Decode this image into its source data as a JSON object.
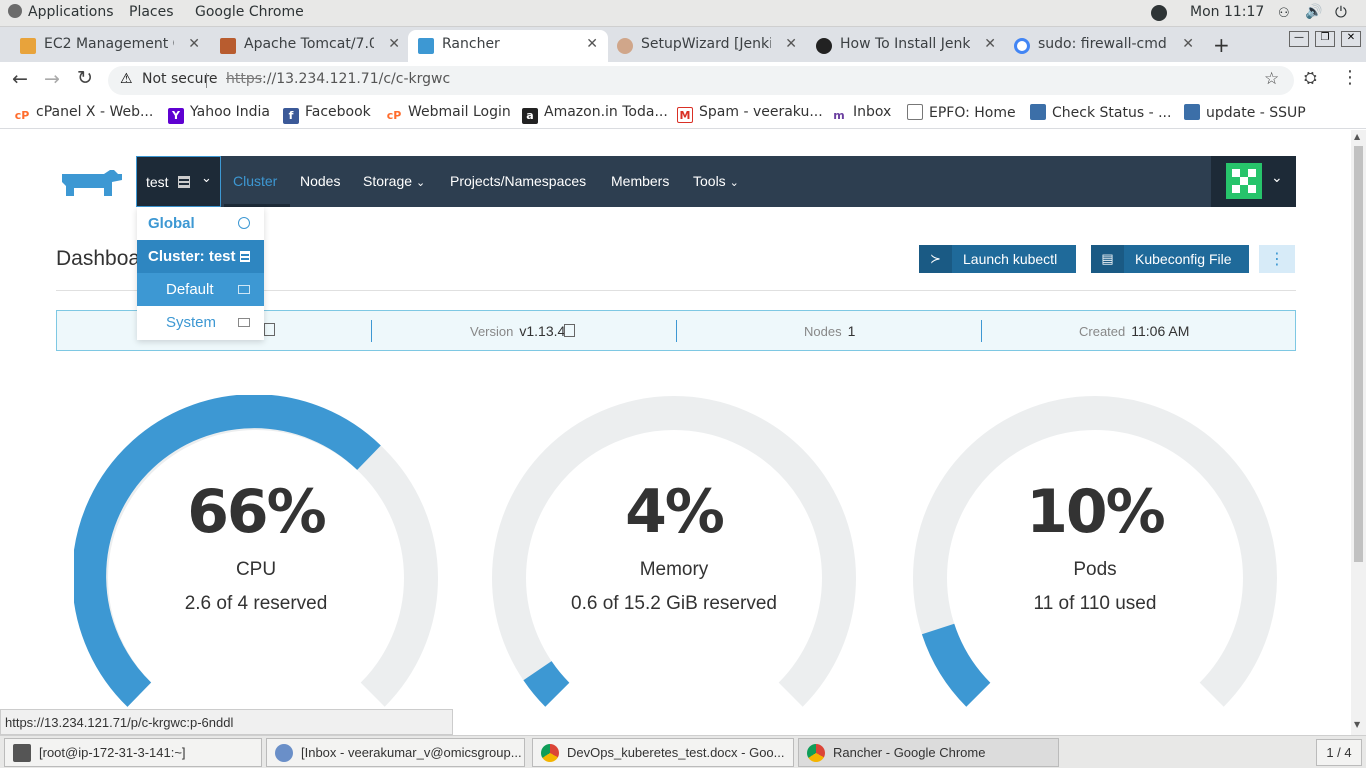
{
  "system": {
    "applications": "Applications",
    "places": "Places",
    "app_name": "Google Chrome",
    "clock": "Mon 11:17"
  },
  "tabs": [
    {
      "title": "EC2 Management Co",
      "active": false
    },
    {
      "title": "Apache Tomcat/7.0.",
      "active": false
    },
    {
      "title": "Rancher",
      "active": true
    },
    {
      "title": "SetupWizard [Jenkin",
      "active": false
    },
    {
      "title": "How To Install Jenki",
      "active": false
    },
    {
      "title": "sudo: firewall-cmd: c",
      "active": false
    }
  ],
  "omnibox": {
    "security": "Not secure",
    "url_scheme": "https",
    "url_rest": "://13.234.121.71/c/c-krgwc"
  },
  "bookmarks": [
    {
      "label": "cPanel X - Web..."
    },
    {
      "label": "Yahoo India"
    },
    {
      "label": "Facebook"
    },
    {
      "label": "Webmail Login"
    },
    {
      "label": "Amazon.in Toda..."
    },
    {
      "label": "Spam - veeraku..."
    },
    {
      "label": "Inbox"
    },
    {
      "label": "EPFO: Home"
    },
    {
      "label": "Check Status - ..."
    },
    {
      "label": "update - SSUP"
    }
  ],
  "rancher_nav": {
    "cluster_selector": "test",
    "items": [
      "Cluster",
      "Nodes",
      "Storage",
      "Projects/Namespaces",
      "Members",
      "Tools"
    ]
  },
  "dropdown": {
    "global": "Global",
    "cluster": "Cluster: test",
    "projects": [
      "Default",
      "System"
    ]
  },
  "dashboard": {
    "title": "Dashboard",
    "launch_kubectl": "Launch kubectl",
    "kubeconfig": "Kubeconfig File"
  },
  "info": {
    "version_label": "Version",
    "version_value": "v1.13.4",
    "nodes_label": "Nodes",
    "nodes_value": "1",
    "created_label": "Created",
    "created_value": "11:06 AM"
  },
  "gauges": [
    {
      "percent_text": "66%",
      "value": 0.66,
      "label": "CPU",
      "detail": "2.6 of 4 reserved"
    },
    {
      "percent_text": "4%",
      "value": 0.04,
      "label": "Memory",
      "detail": "0.6 of 15.2 GiB reserved"
    },
    {
      "percent_text": "10%",
      "value": 0.1,
      "label": "Pods",
      "detail": "11 of 110 used"
    }
  ],
  "status_url": "https://13.234.121.71/p/c-krgwc:p-6nddl",
  "taskbar": [
    {
      "label": "[root@ip-172-31-3-141:~]"
    },
    {
      "label": "[Inbox - veerakumar_v@omicsgroup..."
    },
    {
      "label": "DevOps_kuberetes_test.docx - Goo..."
    },
    {
      "label": "Rancher - Google Chrome"
    }
  ],
  "workspace": "1 / 4",
  "colors": {
    "rancher_blue": "#3d98d3",
    "gauge_track": "#eceeef",
    "nav_bg": "#2d3e50",
    "button_bg": "#1f6a9a"
  }
}
